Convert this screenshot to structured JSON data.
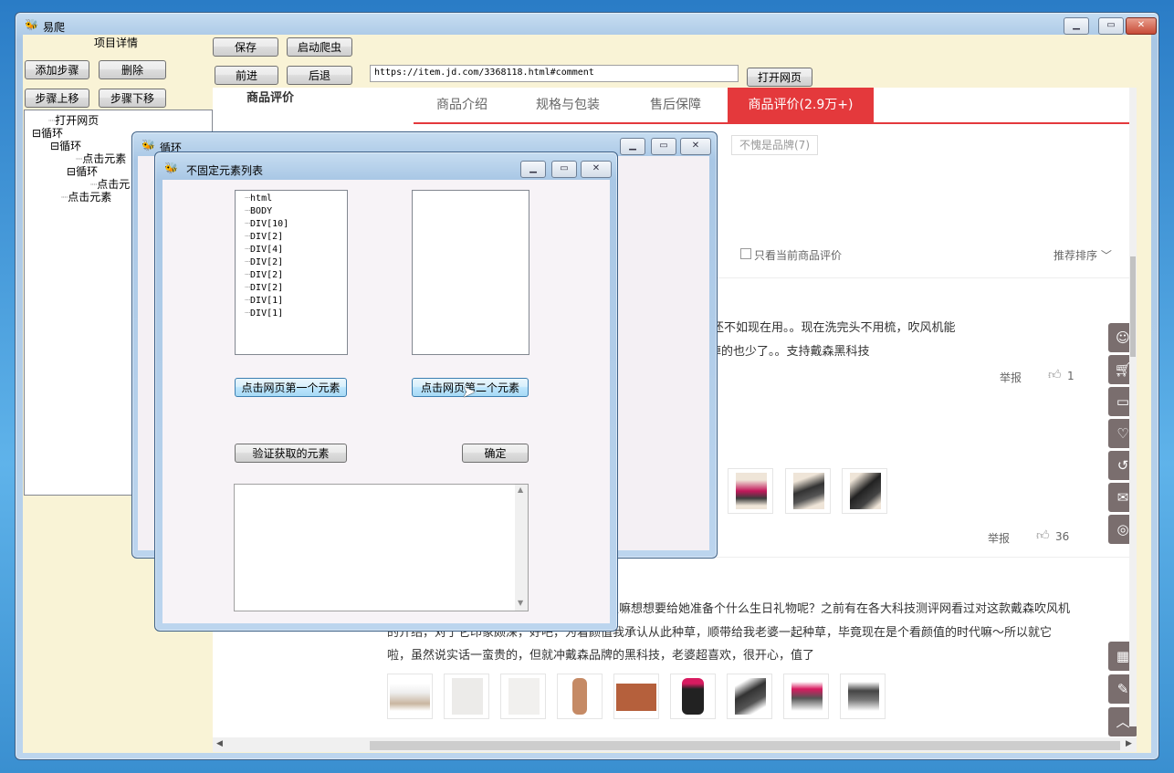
{
  "main_window": {
    "title": "易爬",
    "left_panel": {
      "heading": "项目详情",
      "buttons": {
        "add_step": "添加步骤",
        "delete": "删除",
        "step_up": "步骤上移",
        "step_down": "步骤下移"
      },
      "tree": [
        "打开网页",
        "循环",
        "循环",
        "点击元素",
        "循环",
        "点击元",
        "点击元素"
      ]
    },
    "toolbar": {
      "save": "保存",
      "start_crawler": "启动爬虫",
      "forward": "前进",
      "back": "后退",
      "url": "https://item.jd.com/3368118.html#comment",
      "open_page": "打开网页"
    }
  },
  "webpage": {
    "section_title": "商品评价",
    "tabs": [
      "商品介绍",
      "规格与包装",
      "售后保障",
      "商品评价(2.9万+)"
    ],
    "tag": "不愧是品牌(7)",
    "only_current": "只看当前商品评价",
    "sort": "推荐排序",
    "review1": {
      "line1": "看着怀孕时也要买，还不如现在用。。现在洗完头不用梳，吹风机能",
      "line2": "之前有光泽很多，掉的也少了。。支持戴森黑科技",
      "report": "举报",
      "likes": "1"
    },
    "review2": {
      "report": "举报",
      "likes": "36"
    },
    "review3": {
      "line1": "以嘛想想要给她准备个什么生日礼物呢？之前有在各大科技测评网看过对这款戴森吹风机",
      "line2": "的介绍，对于它印象颇深，好吧，为着颜值我承认从此种草，顺带给我老婆一起种草，毕竟现在是个看颜值的时代嘛～所以就它",
      "line3": "啦，虽然说实话一蛮贵的，但就冲戴森品牌的黑科技，老婆超喜欢，很开心，值了"
    },
    "sidebar_icons": [
      "user-icon",
      "cart-icon",
      "card-icon",
      "heart-icon",
      "history-icon",
      "chat-icon",
      "service-icon",
      "qrcode-icon",
      "edit-icon",
      "top-icon"
    ]
  },
  "loop_window": {
    "title": "循环"
  },
  "element_list_window": {
    "title": "不固定元素列表",
    "left_list": [
      "html",
      "BODY",
      "DIV[10]",
      "DIV[2]",
      "DIV[4]",
      "DIV[2]",
      "DIV[2]",
      "DIV[2]",
      "DIV[1]",
      "DIV[1]"
    ],
    "buttons": {
      "click_first": "点击网页第一个元素",
      "click_second": "点击网页第二个元素",
      "verify": "验证获取的元素",
      "confirm": "确定"
    }
  },
  "colors": {
    "jd_red": "#e4393c",
    "panel_bg": "#f9f3d6",
    "sidebar_icon_bg": "#7a6e6e"
  }
}
